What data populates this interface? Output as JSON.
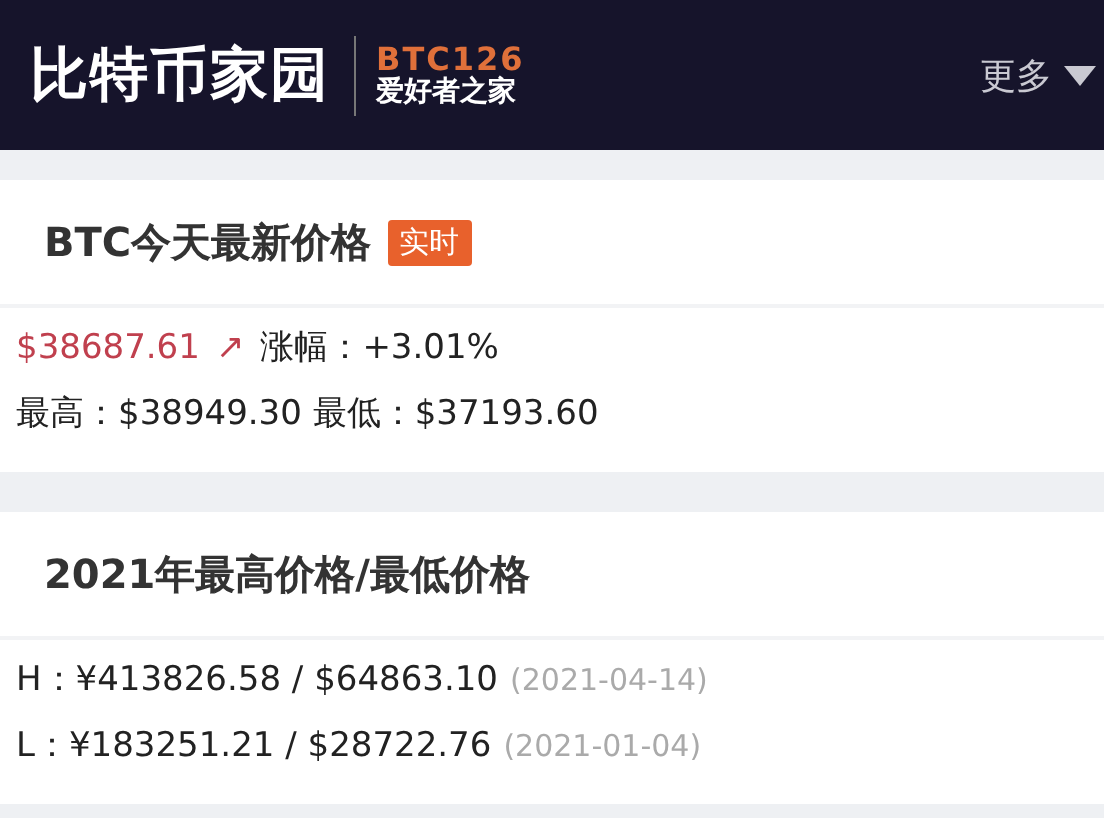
{
  "header": {
    "logo": "比特币家园",
    "brand_code": "BTC126",
    "brand_slogan": "爱好者之家",
    "more_menu": "更多"
  },
  "today_card": {
    "title": "BTC今天最新价格",
    "badge": "实时",
    "price": "$38687.61",
    "trend_arrow": "↗",
    "change": "涨幅：+3.01%",
    "high_low": "最高：$38949.30 最低：$37193.60"
  },
  "year_card": {
    "title": "2021年最高价格/最低价格",
    "rows": [
      {
        "value": "H：¥413826.58 / $64863.10",
        "date": "(2021-04-14)"
      },
      {
        "value": "L：¥183251.21 / $28722.76",
        "date": "(2021-01-04)"
      }
    ]
  }
}
